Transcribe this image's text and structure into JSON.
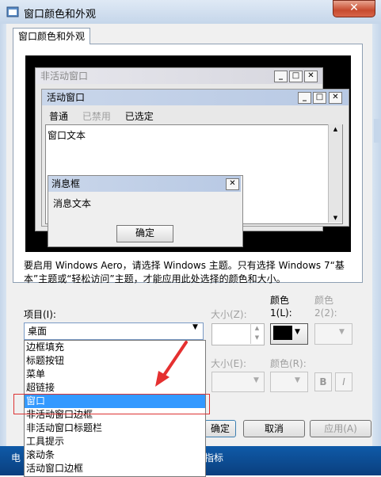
{
  "window": {
    "title": "窗口颜色和外观",
    "close_symbol": "✕"
  },
  "tab": {
    "label": "窗口颜色和外观"
  },
  "preview": {
    "inactive_title": "非活动窗口",
    "active_title": "活动窗口",
    "menu": {
      "normal": "普通",
      "disabled": "已禁用",
      "selected": "已选定"
    },
    "window_text": "窗口文本",
    "msgbox_title": "消息框",
    "msgbox_text": "消息文本",
    "ok": "确定",
    "caption_buttons": {
      "min": "_",
      "max": "□",
      "close": "✕"
    }
  },
  "description": "要启用 Windows Aero，请选择 Windows 主题。只有选择 Windows 7“基本”主题或“轻松访问”主题，才能应用此处选择的颜色和大小。",
  "controls": {
    "item_label": "项目(I):",
    "item_value": "桌面",
    "size_label": "大小(Z):",
    "color1_label_a": "颜色",
    "color1_label_b": "1(L):",
    "color2_label_a": "颜色",
    "color2_label_b": "2(2):",
    "font_size_label": "大小(E):",
    "font_color_label": "颜色(R):",
    "bold": "B",
    "italic": "I",
    "color1_value": "#000000",
    "arrow_symbol": "▼"
  },
  "dropdown": {
    "items": [
      "边框填充",
      "标题按钮",
      "菜单",
      "超链接",
      "窗口",
      "非活动窗口边框",
      "非活动窗口标题栏",
      "工具提示",
      "滚动条",
      "活动窗口边框"
    ],
    "selected_index": 4
  },
  "buttons": {
    "ok": "确定",
    "cancel": "取消",
    "apply": "应用(A)"
  },
  "taskbar": {
    "left": "电",
    "right": "指标"
  }
}
